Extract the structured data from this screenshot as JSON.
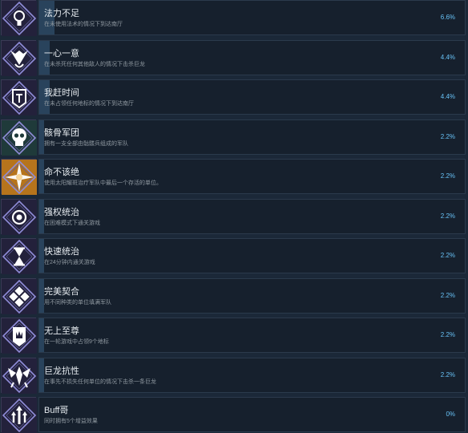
{
  "achievements": [
    {
      "title": "法力不足",
      "description": "在未使用法术的情况下到达南厅",
      "percent": "6.6%",
      "progress": 0.066,
      "icon": "bulb-icon",
      "icon_bg": "#23213b"
    },
    {
      "title": "一心一意",
      "description": "在未杀死任何其他敌人的情况下击杀巨龙",
      "percent": "4.4%",
      "progress": 0.044,
      "icon": "dragon-crest-icon",
      "icon_bg": "#23213b"
    },
    {
      "title": "我赶时间",
      "description": "在未占领任何地标的情况下到达南厅",
      "percent": "4.4%",
      "progress": 0.044,
      "icon": "banner-icon",
      "icon_bg": "#23213b"
    },
    {
      "title": "骸骨军团",
      "description": "拥有一支全部由骷髅兵组成的军队",
      "percent": "2.2%",
      "progress": 0.022,
      "icon": "skull-icon",
      "icon_bg": "#1f3a3a"
    },
    {
      "title": "命不该绝",
      "description": "使用太阳耀斑治疗军队中最后一个存活的单位。",
      "percent": "2.2%",
      "progress": 0.022,
      "icon": "starburst-icon",
      "icon_bg": "#b6741c"
    },
    {
      "title": "强权统治",
      "description": "在困难模式下通关游戏",
      "percent": "2.2%",
      "progress": 0.022,
      "icon": "target-icon",
      "icon_bg": "#23213b"
    },
    {
      "title": "快速统治",
      "description": "在24分钟内通关游戏",
      "percent": "2.2%",
      "progress": 0.022,
      "icon": "hourglass-icon",
      "icon_bg": "#23213b"
    },
    {
      "title": "完美契合",
      "description": "用不同种类的单位填满军队",
      "percent": "2.2%",
      "progress": 0.022,
      "icon": "grid-tile-icon",
      "icon_bg": "#23213b"
    },
    {
      "title": "无上至尊",
      "description": "在一轮游戏中占领9个地标",
      "percent": "2.2%",
      "progress": 0.022,
      "icon": "crown-banner-icon",
      "icon_bg": "#23213b"
    },
    {
      "title": "巨龙抗性",
      "description": "在事先不损失任何单位的情况下击杀一条巨龙",
      "percent": "2.2%",
      "progress": 0.022,
      "icon": "winged-emblem-icon",
      "icon_bg": "#23213b"
    },
    {
      "title": "Buff哥",
      "description": "同时拥有5个增益效果",
      "percent": "0%",
      "progress": 0,
      "icon": "arrows-up-icon",
      "icon_bg": "#23213b"
    }
  ]
}
